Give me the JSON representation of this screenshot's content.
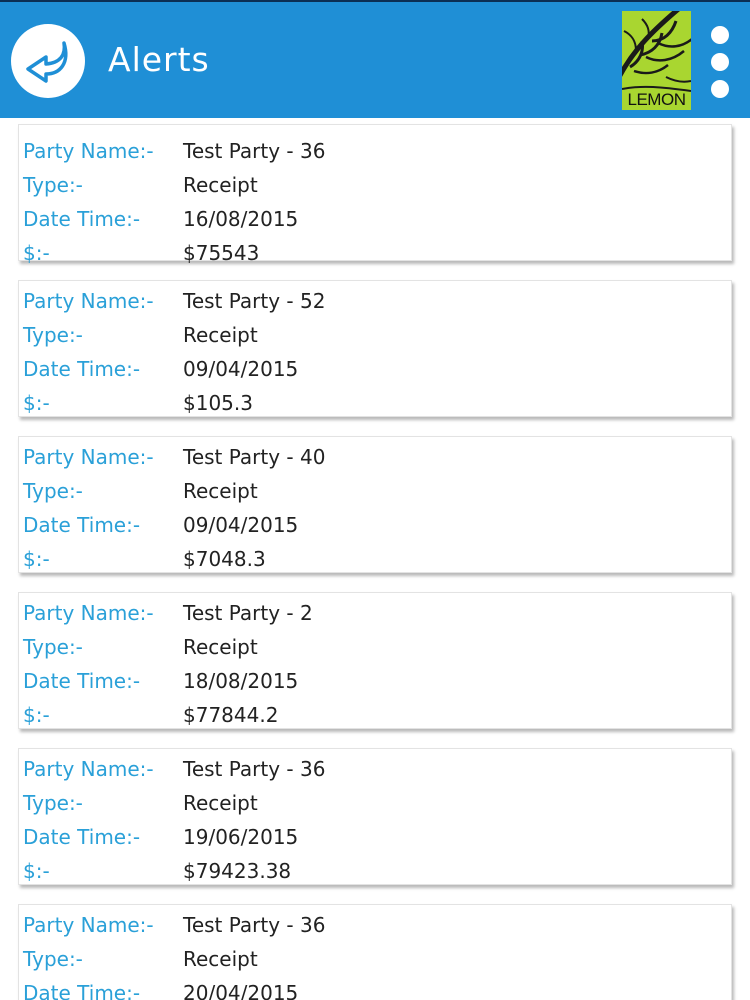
{
  "header": {
    "title": "Alerts",
    "back_icon": "back-arrow-icon",
    "logo_text": "LEMON",
    "menu_icon": "more-vertical-icon",
    "bar_color": "#1f8fd6"
  },
  "labels": {
    "party_name": "Party Name:-",
    "type": "Type:-",
    "date_time": "Date Time:-",
    "amount": "$:-"
  },
  "alerts": [
    {
      "party": "Test Party - 36",
      "type": "Receipt",
      "date": "16/08/2015",
      "amount": "$75543"
    },
    {
      "party": "Test Party - 52",
      "type": "Receipt",
      "date": "09/04/2015",
      "amount": "$105.3"
    },
    {
      "party": "Test Party - 40",
      "type": "Receipt",
      "date": "09/04/2015",
      "amount": "$7048.3"
    },
    {
      "party": "Test Party - 2",
      "type": "Receipt",
      "date": "18/08/2015",
      "amount": "$77844.2"
    },
    {
      "party": "Test Party - 36",
      "type": "Receipt",
      "date": "19/06/2015",
      "amount": "$79423.38"
    },
    {
      "party": "Test Party - 36",
      "type": "Receipt",
      "date": "20/04/2015",
      "amount": ""
    }
  ]
}
